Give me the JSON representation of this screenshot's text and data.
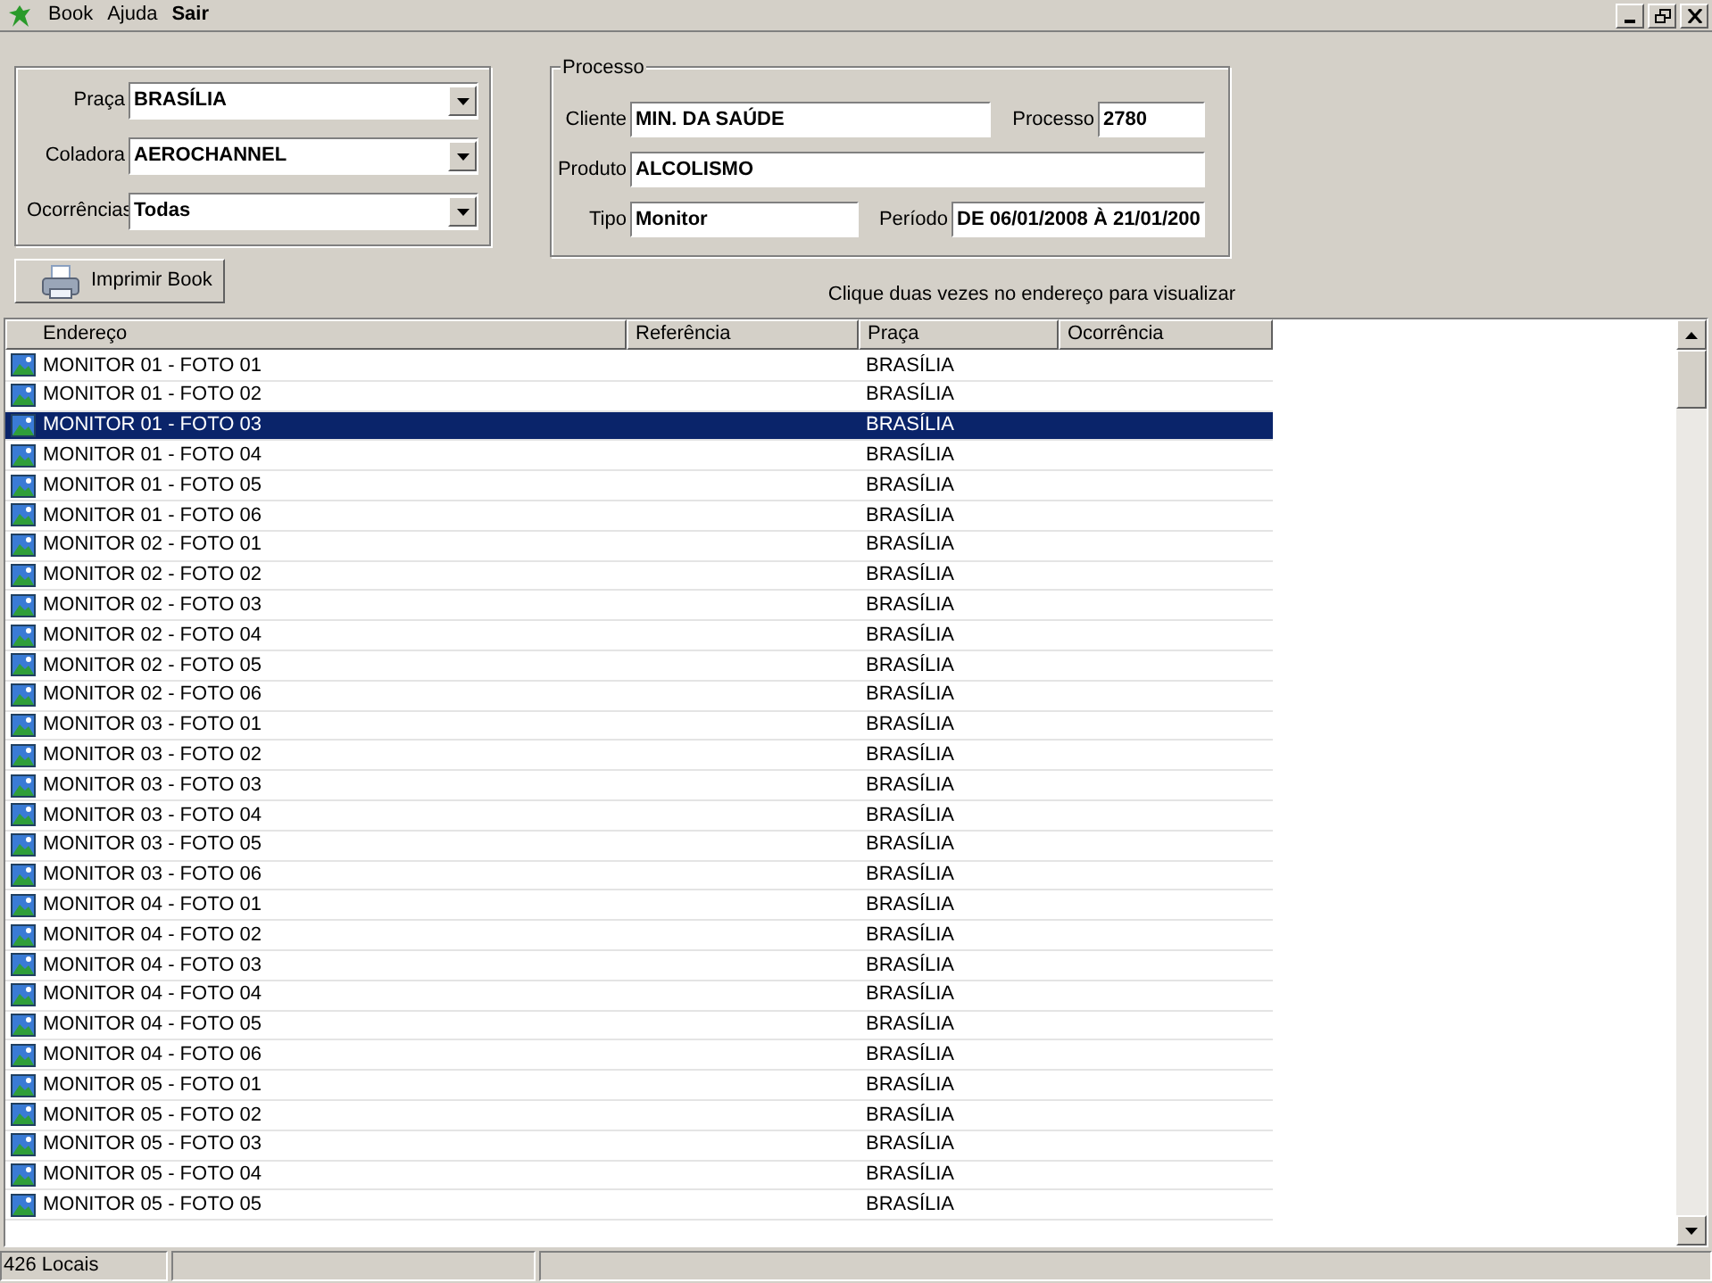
{
  "menu": [
    {
      "label": "Book",
      "bold": false
    },
    {
      "label": "Ajuda",
      "bold": false
    },
    {
      "label": "Sair",
      "bold": true
    }
  ],
  "filters": [
    {
      "label": "Praça",
      "value": "BRASÍLIA"
    },
    {
      "label": "Coladora",
      "value": "AEROCHANNEL"
    },
    {
      "label": "Ocorrências",
      "value": "Todas"
    }
  ],
  "print_button": "Imprimir Book",
  "processo": {
    "title": "Processo",
    "cliente_label": "Cliente",
    "cliente": "MIN. DA SAÚDE",
    "processo_label": "Processo",
    "processo": "2780",
    "produto_label": "Produto",
    "produto": "ALCOLISMO",
    "tipo_label": "Tipo",
    "tipo": "Monitor",
    "periodo_label": "Período",
    "periodo": "DE 06/01/2008 À 21/01/200"
  },
  "hint": "Clique duas vezes no endereço para visualizar",
  "table": {
    "columns": [
      "Endereço",
      "Referência",
      "Praça",
      "Ocorrência"
    ],
    "rows": [
      {
        "endereco": "MONITOR 01 - FOTO 01",
        "praca": "BRASÍLIA",
        "selected": false
      },
      {
        "endereco": "MONITOR 01 - FOTO 02",
        "praca": "BRASÍLIA",
        "selected": false
      },
      {
        "endereco": "MONITOR 01 - FOTO 03",
        "praca": "BRASÍLIA",
        "selected": true
      },
      {
        "endereco": "MONITOR 01 - FOTO 04",
        "praca": "BRASÍLIA",
        "selected": false
      },
      {
        "endereco": "MONITOR 01 - FOTO 05",
        "praca": "BRASÍLIA",
        "selected": false
      },
      {
        "endereco": "MONITOR 01 - FOTO 06",
        "praca": "BRASÍLIA",
        "selected": false
      },
      {
        "endereco": "MONITOR 02 - FOTO 01",
        "praca": "BRASÍLIA",
        "selected": false
      },
      {
        "endereco": "MONITOR 02 - FOTO 02",
        "praca": "BRASÍLIA",
        "selected": false
      },
      {
        "endereco": "MONITOR 02 - FOTO 03",
        "praca": "BRASÍLIA",
        "selected": false
      },
      {
        "endereco": "MONITOR 02 - FOTO 04",
        "praca": "BRASÍLIA",
        "selected": false
      },
      {
        "endereco": "MONITOR 02 - FOTO 05",
        "praca": "BRASÍLIA",
        "selected": false
      },
      {
        "endereco": "MONITOR 02 - FOTO 06",
        "praca": "BRASÍLIA",
        "selected": false
      },
      {
        "endereco": "MONITOR 03 - FOTO 01",
        "praca": "BRASÍLIA",
        "selected": false
      },
      {
        "endereco": "MONITOR 03 - FOTO 02",
        "praca": "BRASÍLIA",
        "selected": false
      },
      {
        "endereco": "MONITOR 03 - FOTO 03",
        "praca": "BRASÍLIA",
        "selected": false
      },
      {
        "endereco": "MONITOR 03 - FOTO 04",
        "praca": "BRASÍLIA",
        "selected": false
      },
      {
        "endereco": "MONITOR 03 - FOTO 05",
        "praca": "BRASÍLIA",
        "selected": false
      },
      {
        "endereco": "MONITOR 03 - FOTO 06",
        "praca": "BRASÍLIA",
        "selected": false
      },
      {
        "endereco": "MONITOR 04 - FOTO 01",
        "praca": "BRASÍLIA",
        "selected": false
      },
      {
        "endereco": "MONITOR 04 - FOTO 02",
        "praca": "BRASÍLIA",
        "selected": false
      },
      {
        "endereco": "MONITOR 04 - FOTO 03",
        "praca": "BRASÍLIA",
        "selected": false
      },
      {
        "endereco": "MONITOR 04 - FOTO 04",
        "praca": "BRASÍLIA",
        "selected": false
      },
      {
        "endereco": "MONITOR 04 - FOTO 05",
        "praca": "BRASÍLIA",
        "selected": false
      },
      {
        "endereco": "MONITOR 04 - FOTO 06",
        "praca": "BRASÍLIA",
        "selected": false
      },
      {
        "endereco": "MONITOR 05 - FOTO 01",
        "praca": "BRASÍLIA",
        "selected": false
      },
      {
        "endereco": "MONITOR 05 - FOTO 02",
        "praca": "BRASÍLIA",
        "selected": false
      },
      {
        "endereco": "MONITOR 05 - FOTO 03",
        "praca": "BRASÍLIA",
        "selected": false
      },
      {
        "endereco": "MONITOR 05 - FOTO 04",
        "praca": "BRASÍLIA",
        "selected": false
      },
      {
        "endereco": "MONITOR 05 - FOTO 05",
        "praca": "BRASÍLIA",
        "selected": false
      }
    ]
  },
  "status_bar": [
    "426 Locais"
  ]
}
